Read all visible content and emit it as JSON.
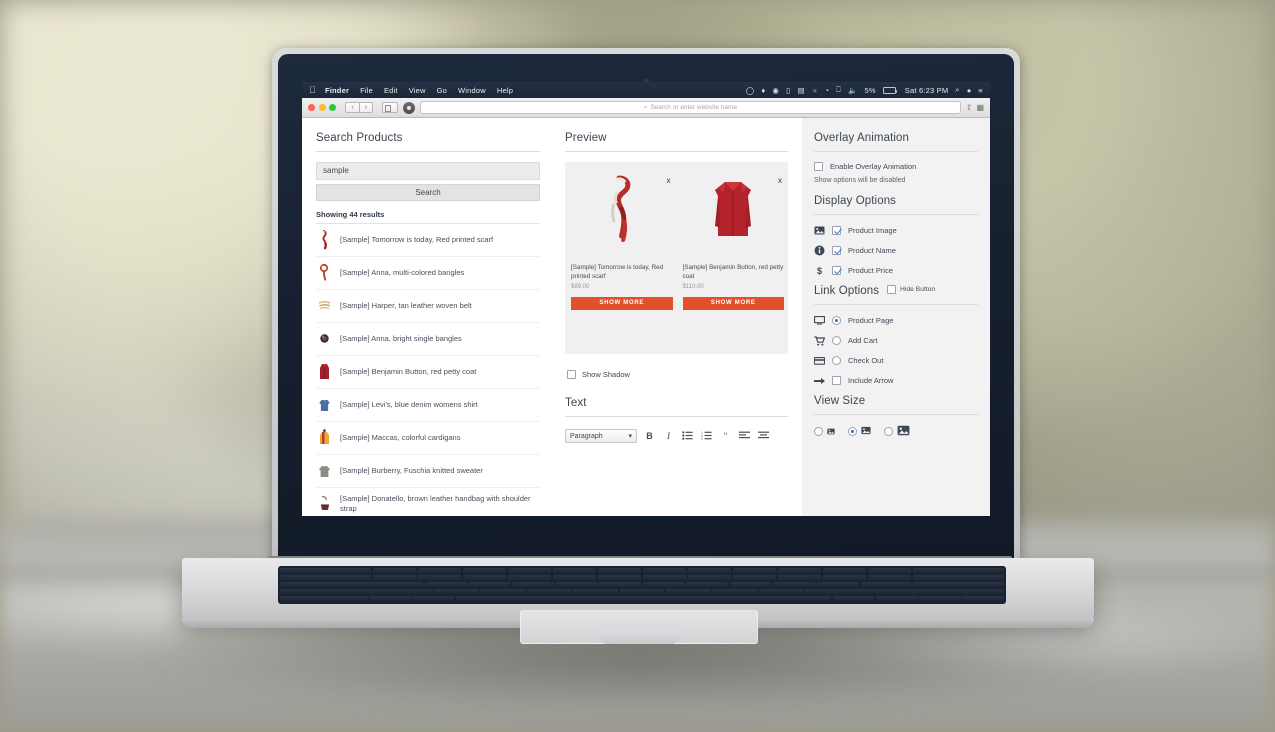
{
  "os": {
    "menubar": {
      "apple_icon": "apple-icon",
      "items": [
        "Finder",
        "File",
        "Edit",
        "View",
        "Go",
        "Window",
        "Help"
      ],
      "status_icons": [
        "timemachine-icon",
        "dropbox-icon",
        "cloud-icon",
        "display-icon",
        "keyboard-icon",
        "bluetooth-icon",
        "wifi-icon",
        "airplay-icon",
        "volume-icon"
      ],
      "battery_percent": "5%",
      "clock": "Sat 6:23 PM",
      "right_icons": [
        "search-icon",
        "siri-icon",
        "notification-center-icon"
      ]
    }
  },
  "browser": {
    "traffic_lights": [
      "close",
      "minimize",
      "zoom"
    ],
    "back_label": "‹",
    "forward_label": "›",
    "address_placeholder": "Search or enter website name",
    "search_icon": "search-icon"
  },
  "left_panel": {
    "title": "Search Products",
    "search_value": "sample",
    "search_placeholder": "sample",
    "search_button": "Search",
    "results_count": "Showing 44 results",
    "products": [
      {
        "name": "[Sample] Tomorrow is today, Red printed scarf",
        "thumb": "scarf-thumb"
      },
      {
        "name": "[Sample] Anna, multi-colored bangles",
        "thumb": "bangles-thumb"
      },
      {
        "name": "[Sample] Harper, tan leather woven belt",
        "thumb": "belt-thumb"
      },
      {
        "name": "[Sample] Anna, bright single bangles",
        "thumb": "bangle-thumb"
      },
      {
        "name": "[Sample] Benjamin Button, red petty coat",
        "thumb": "coat-thumb"
      },
      {
        "name": "[Sample] Levi's, blue denim womens shirt",
        "thumb": "shirt-thumb"
      },
      {
        "name": "[Sample] Maccas, colorful cardigans",
        "thumb": "cardigan-thumb"
      },
      {
        "name": "[Sample] Burberry, Fuschia knitted sweater",
        "thumb": "sweater-thumb"
      },
      {
        "name": "[Sample] Donatello, brown leather handbag with shoulder strap",
        "thumb": "handbag-thumb"
      }
    ]
  },
  "preview_panel": {
    "title": "Preview",
    "close_label": "x",
    "cards": [
      {
        "title": "[Sample] Tomorrow is today, Red printed scarf",
        "price": "$89.00",
        "button": "SHOW MORE"
      },
      {
        "title": "[Sample] Benjamin Button, red petty coat",
        "price": "$110.00",
        "button": "SHOW MORE"
      }
    ],
    "show_shadow_label": "Show Shadow",
    "show_shadow_checked": false,
    "text_section_title": "Text",
    "toolbar": {
      "format_select": "Paragraph",
      "caret_icon": "chevron-down-icon",
      "bold": "B",
      "italic": "I",
      "bullet_list": "bullet-list-icon",
      "numbered_list": "numbered-list-icon",
      "blockquote": "“",
      "align_left": "align-left-icon",
      "align_center": "align-center-icon"
    }
  },
  "right_panel": {
    "overlay": {
      "title": "Overlay Animation",
      "enable_label": "Enable Overlay Animation",
      "enable_checked": false,
      "note": "Show options will be disabled"
    },
    "display": {
      "title": "Display Options",
      "options": [
        {
          "label": "Product Image",
          "icon": "image-icon",
          "checked": true
        },
        {
          "label": "Product Name",
          "icon": "info-icon",
          "checked": true
        },
        {
          "label": "Product Price",
          "icon": "dollar-icon",
          "checked": true
        }
      ]
    },
    "link": {
      "title": "Link Options",
      "hide_button_label": "Hide Button",
      "hide_button_checked": false,
      "options": [
        {
          "label": "Product Page",
          "icon": "monitor-icon",
          "type": "radio",
          "selected": true
        },
        {
          "label": "Add Cart",
          "icon": "cart-icon",
          "type": "radio",
          "selected": false
        },
        {
          "label": "Check Out",
          "icon": "credit-card-icon",
          "type": "radio",
          "selected": false
        },
        {
          "label": "Include Arrow",
          "icon": "arrow-right-icon",
          "type": "checkbox",
          "selected": false
        }
      ]
    },
    "view_size": {
      "title": "View Size",
      "options": [
        {
          "icon": "image-small-icon",
          "selected": false
        },
        {
          "icon": "image-medium-icon",
          "selected": true
        },
        {
          "icon": "image-large-icon",
          "selected": false
        }
      ]
    }
  },
  "colors": {
    "accent_button": "#e2512b",
    "checkbox_blue": "#3b7fd4",
    "radio_blue": "#2d6fc4",
    "panel_bg": "#f2f2f2"
  }
}
